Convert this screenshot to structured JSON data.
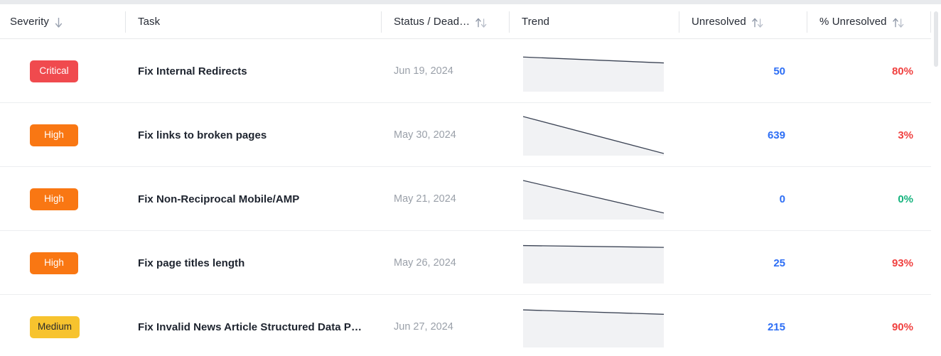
{
  "table": {
    "columns": [
      {
        "id": "severity",
        "label": "Severity",
        "sort_icon": "sort-desc-arrow-icon",
        "sort_state": "desc",
        "align": "left"
      },
      {
        "id": "task",
        "label": "Task",
        "sort_icon": null,
        "sort_state": "none",
        "align": "left"
      },
      {
        "id": "status_deadline",
        "label": "Status / Dead…",
        "sort_icon": "sort-updown-arrows-icon",
        "sort_state": "none",
        "align": "left"
      },
      {
        "id": "trend",
        "label": "Trend",
        "sort_icon": null,
        "sort_state": "none",
        "align": "left"
      },
      {
        "id": "unresolved",
        "label": "Unresolved",
        "sort_icon": "sort-updown-arrows-icon",
        "sort_state": "none",
        "align": "left"
      },
      {
        "id": "pct_unresolved",
        "label": "% Unresolved",
        "sort_icon": "sort-updown-arrows-icon",
        "sort_state": "none",
        "align": "left"
      }
    ],
    "rows": [
      {
        "severity": "Critical",
        "severity_color": "#f04a4e",
        "severity_text_color": "#ffffff",
        "task": "Fix Internal Redirects",
        "deadline": "Jun 19, 2024",
        "unresolved": "50",
        "pct_unresolved": "80%",
        "pct_color": "#f0403f",
        "trend": {
          "start": 0.88,
          "end": 0.72
        }
      },
      {
        "severity": "High",
        "severity_color": "#f97713",
        "severity_text_color": "#ffffff",
        "task": "Fix links to broken pages",
        "deadline": "May 30, 2024",
        "unresolved": "639",
        "pct_unresolved": "3%",
        "pct_color": "#f0403f",
        "trend": {
          "start": 1.0,
          "end": 0.0
        }
      },
      {
        "severity": "High",
        "severity_color": "#f97713",
        "severity_text_color": "#ffffff",
        "task": "Fix Non-Reciprocal Mobile/AMP",
        "deadline": "May 21, 2024",
        "unresolved": "0",
        "pct_unresolved": "0%",
        "pct_color": "#14b37d",
        "trend": {
          "start": 1.0,
          "end": 0.12
        }
      },
      {
        "severity": "High",
        "severity_color": "#f97713",
        "severity_text_color": "#ffffff",
        "task": "Fix page titles length",
        "deadline": "May 26, 2024",
        "unresolved": "25",
        "pct_unresolved": "93%",
        "pct_color": "#f0403f",
        "trend": {
          "start": 0.97,
          "end": 0.92
        }
      },
      {
        "severity": "Medium",
        "severity_color": "#f7c32e",
        "severity_text_color": "#2b2b2b",
        "task": "Fix Invalid News Article Structured Data P…",
        "deadline": "Jun 27, 2024",
        "unresolved": "215",
        "pct_unresolved": "90%",
        "pct_color": "#f0403f",
        "trend": {
          "start": 0.96,
          "end": 0.84
        }
      }
    ]
  },
  "chart_data": {
    "type": "area",
    "title": "Trend",
    "xlabel": "",
    "ylabel": "",
    "grid": false,
    "legend": "none",
    "axis_range_y": [
      0,
      1
    ],
    "series": [
      {
        "name": "Fix Internal Redirects",
        "x": [
          0,
          1
        ],
        "values": [
          0.88,
          0.72
        ]
      },
      {
        "name": "Fix links to broken pages",
        "x": [
          0,
          1
        ],
        "values": [
          1.0,
          0.0
        ]
      },
      {
        "name": "Fix Non-Reciprocal Mobile/AMP",
        "x": [
          0,
          1
        ],
        "values": [
          1.0,
          0.12
        ]
      },
      {
        "name": "Fix page titles length",
        "x": [
          0,
          1
        ],
        "values": [
          0.97,
          0.92
        ]
      },
      {
        "name": "Fix Invalid News Article Structured Data P…",
        "x": [
          0,
          1
        ],
        "values": [
          0.96,
          0.84
        ]
      }
    ],
    "fill_color": "#f1f2f4",
    "line_color": "#3b4354"
  },
  "colors": {
    "accent_blue": "#2d6ef5",
    "danger_red": "#f0403f",
    "success_green": "#14b37d",
    "critical": "#f04a4e",
    "high": "#f97713",
    "medium": "#f7c32e",
    "border": "#eceef0",
    "header_text": "#262b35",
    "muted_text": "#9aa0a9"
  }
}
